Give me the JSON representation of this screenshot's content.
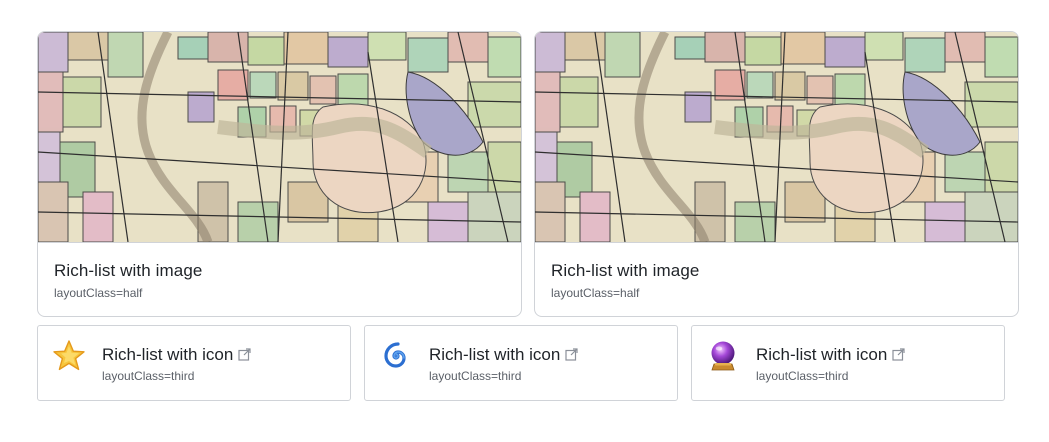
{
  "cards_half": [
    {
      "title": "Rich-list with image",
      "subtitle": "layoutClass=half",
      "image": "parcel-map-thumbnail"
    },
    {
      "title": "Rich-list with image",
      "subtitle": "layoutClass=half",
      "image": "parcel-map-thumbnail"
    }
  ],
  "cards_third": [
    {
      "title": "Rich-list with icon",
      "subtitle": "layoutClass=third",
      "icon": "star-icon",
      "link_icon": "external-link-icon"
    },
    {
      "title": "Rich-list with icon",
      "subtitle": "layoutClass=third",
      "icon": "cyclone-icon",
      "link_icon": "external-link-icon"
    },
    {
      "title": "Rich-list with icon",
      "subtitle": "layoutClass=third",
      "icon": "crystal-ball-icon",
      "link_icon": "external-link-icon"
    }
  ],
  "colors": {
    "border": "#d0d3d8",
    "title_text": "#1f2328",
    "subtitle_text": "#5b6068"
  }
}
